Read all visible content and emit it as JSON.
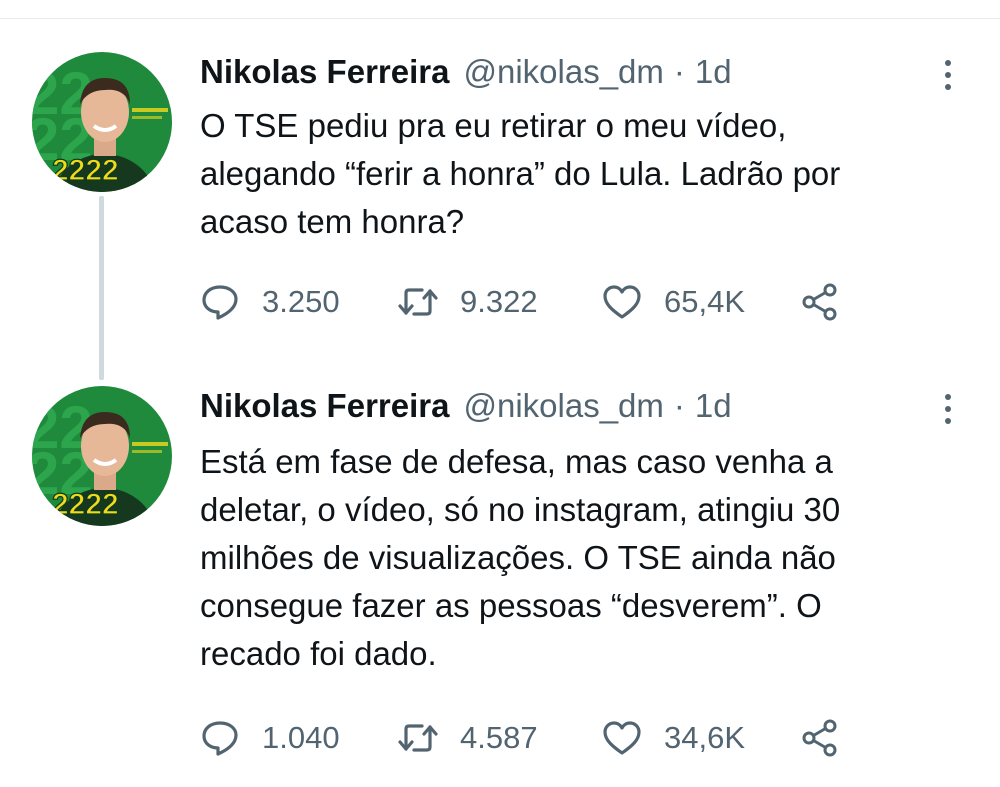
{
  "tweets": [
    {
      "author_name": "Nikolas Ferreira",
      "handle": "@nikolas_dm",
      "separator": "·",
      "time": "1d",
      "text_lines": [
        "O TSE  pediu pra eu retirar o meu vídeo,",
        "alegando “ferir a honra” do Lula. Ladrão por",
        "acaso tem honra?"
      ],
      "avatar_badge": "2222",
      "replies": "3.250",
      "retweets": "9.322",
      "likes": "65,4K"
    },
    {
      "author_name": "Nikolas Ferreira",
      "handle": "@nikolas_dm",
      "separator": "·",
      "time": "1d",
      "text_lines": [
        "Está em fase de defesa, mas caso venha a",
        "deletar, o vídeo, só no instagram, atingiu 30",
        "milhões de visualizações. O TSE ainda não",
        "consegue fazer as pessoas “desverem”. O",
        "recado foi dado."
      ],
      "avatar_badge": "2222",
      "replies": "1.040",
      "retweets": "4.587",
      "likes": "34,6K"
    }
  ],
  "icons": {
    "reply": "reply-icon",
    "retweet": "retweet-icon",
    "like": "heart-icon",
    "share": "share-icon",
    "more": "more-options-icon"
  },
  "colors": {
    "text": "#0f1419",
    "secondary": "#536471",
    "thread_line": "#cfd9de",
    "avatar_green": "#1f8a3c",
    "avatar_yellow": "#f2d91a"
  }
}
